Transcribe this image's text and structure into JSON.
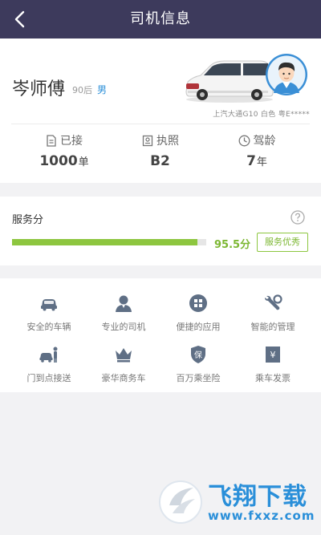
{
  "header": {
    "title": "司机信息"
  },
  "driver": {
    "name": "岑师傅",
    "age_tag": "90后",
    "gender": "男",
    "car_info": "上汽大通G10 白色 粤E*****"
  },
  "stats": [
    {
      "label": "已接",
      "value": "1000",
      "unit": "单",
      "icon": "order-icon"
    },
    {
      "label": "执照",
      "value": "B2",
      "unit": "",
      "icon": "license-icon"
    },
    {
      "label": "驾龄",
      "value": "7",
      "unit": "年",
      "icon": "clock-icon"
    }
  ],
  "service_score": {
    "label": "服务分",
    "value": 95.5,
    "display": "95.5分",
    "badge": "服务优秀",
    "bar_fraction": 0.955,
    "accent_color": "#8dc63f"
  },
  "features": [
    {
      "label": "安全的车辆",
      "icon": "car-icon"
    },
    {
      "label": "专业的司机",
      "icon": "driver-icon"
    },
    {
      "label": "便捷的应用",
      "icon": "apps-icon"
    },
    {
      "label": "智能的管理",
      "icon": "wrench-icon"
    },
    {
      "label": "门到点接送",
      "icon": "pickup-icon"
    },
    {
      "label": "豪华商务车",
      "icon": "crown-icon"
    },
    {
      "label": "百万乘坐险",
      "icon": "insurance-icon"
    },
    {
      "label": "乘车发票",
      "icon": "invoice-icon"
    }
  ],
  "watermark": {
    "title": "飞翔下载",
    "url": "www.fxxz.com"
  },
  "colors": {
    "header_bg": "#3d3a5c",
    "accent": "#8dc63f",
    "gender": "#2b8fd8"
  }
}
